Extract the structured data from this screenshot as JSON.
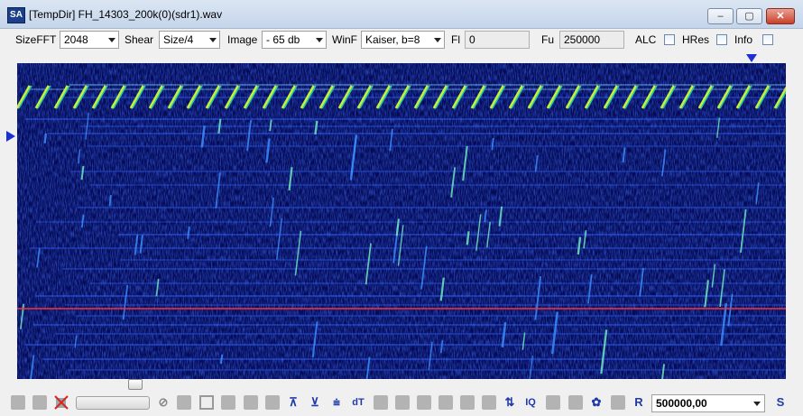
{
  "window": {
    "title": "[TempDir] FH_14303_200k(0)(sdr1).wav",
    "app_icon": "SA",
    "minimize_label": "–",
    "maximize_label": "▢",
    "close_label": "✕"
  },
  "toolbar": {
    "sizefft_label": "SizeFFT",
    "sizefft_value": "2048",
    "shear_label": "Shear",
    "shear_value": "Size/4",
    "image_label": "Image",
    "image_value": "- 65 db",
    "winf_label": "WinF",
    "winf_value": "Kaiser, b=8",
    "fl_label": "Fl",
    "fl_value": "0",
    "fu_label": "Fu",
    "fu_value": "250000",
    "alc_label": "ALC",
    "hres_label": "HRes",
    "info_label": "Info",
    "alc_checked": false,
    "hres_checked": false,
    "info_checked": false
  },
  "spectrogram": {
    "background_color": "#040a55",
    "marker_color": "#1a2fd6",
    "cursor_line_color": "#ff3030"
  },
  "bottombar": {
    "freq_value": "500000,00",
    "icon_up_down": "⇅",
    "icon_dt": "dT",
    "icon_iq": "IQ",
    "icon_r": "R",
    "icon_s": "S",
    "icon_forbid": "⊘"
  }
}
